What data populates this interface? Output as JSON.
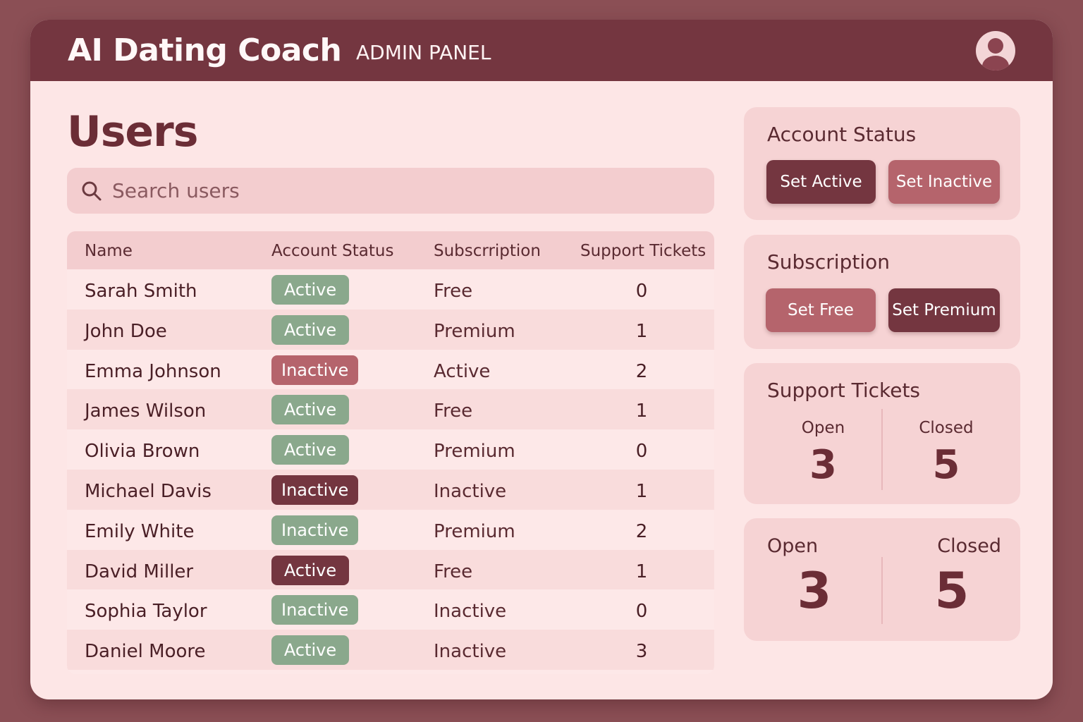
{
  "header": {
    "app_title": "AI Dating Coach",
    "panel_label": "ADMIN PANEL"
  },
  "page": {
    "title": "Users"
  },
  "search": {
    "placeholder": "Search users"
  },
  "table": {
    "columns": [
      "Name",
      "Account Status",
      "Subscrription",
      "Support Tickets"
    ],
    "rows": [
      {
        "name": "Sarah Smith",
        "status": "Active",
        "status_color": "#8aa88c",
        "subscription": "Free",
        "tickets": "0"
      },
      {
        "name": "John Doe",
        "status": "Active",
        "status_color": "#8aa88c",
        "subscription": "Premium",
        "tickets": "1"
      },
      {
        "name": "Emma Johnson",
        "status": "Inactive",
        "status_color": "#b5646c",
        "subscription": "Active",
        "tickets": "2"
      },
      {
        "name": "James Wilson",
        "status": "Active",
        "status_color": "#8aa88c",
        "subscription": "Free",
        "tickets": "1"
      },
      {
        "name": "Olivia Brown",
        "status": "Active",
        "status_color": "#8aa88c",
        "subscription": "Premium",
        "tickets": "0"
      },
      {
        "name": "Michael Davis",
        "status": "Inactive",
        "status_color": "#743640",
        "subscription": "Inactive",
        "tickets": "1"
      },
      {
        "name": "Emily White",
        "status": "Inactive",
        "status_color": "#8aa88c",
        "subscription": "Premium",
        "tickets": "2"
      },
      {
        "name": "David Miller",
        "status": "Active",
        "status_color": "#743640",
        "subscription": "Free",
        "tickets": "1"
      },
      {
        "name": "Sophia Taylor",
        "status": "Inactive",
        "status_color": "#8aa88c",
        "subscription": "Inactive",
        "tickets": "0"
      },
      {
        "name": "Daniel Moore",
        "status": "Active",
        "status_color": "#8aa88c",
        "subscription": "Inactive",
        "tickets": "3"
      }
    ]
  },
  "account_status_card": {
    "title": "Account Status",
    "set_active_label": "Set Active",
    "set_inactive_label": "Set Inactive"
  },
  "subscription_card": {
    "title": "Subscription",
    "set_free_label": "Set Free",
    "set_premium_label": "Set Premium"
  },
  "support_card": {
    "title": "Support Tickets",
    "open_label": "Open",
    "open_value": "3",
    "closed_label": "Closed",
    "closed_value": "5"
  },
  "summary_card": {
    "open_label": "Open",
    "open_value": "3",
    "closed_label": "Closed",
    "closed_value": "5"
  },
  "icons": {
    "search": "search-icon",
    "avatar": "user-avatar-icon"
  },
  "colors": {
    "primary": "#743640",
    "accent": "#b5646c",
    "active_green": "#8aa88c",
    "background": "#8b4f55"
  }
}
